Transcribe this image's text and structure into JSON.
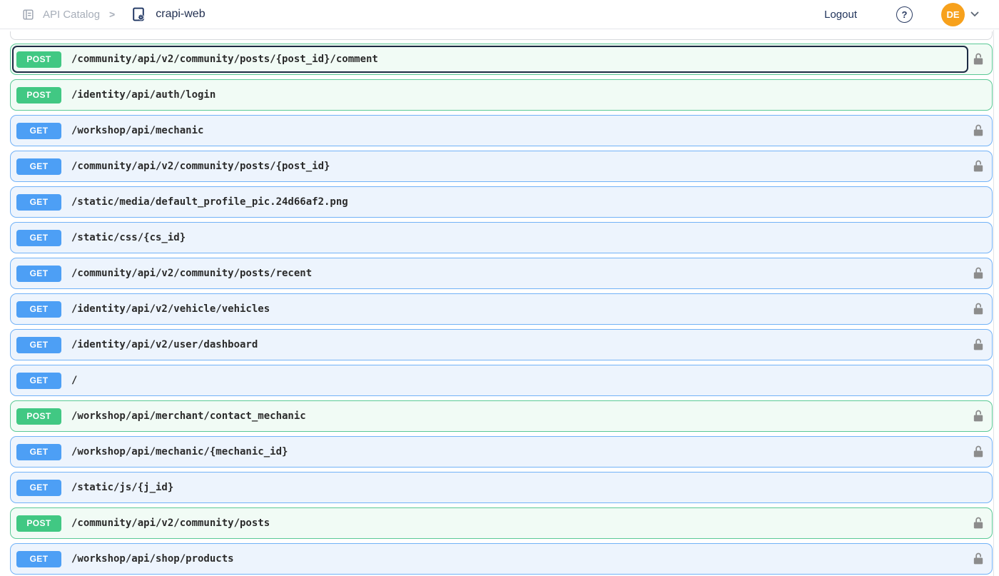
{
  "header": {
    "breadcrumb": {
      "catalog_label": "API Catalog",
      "separator": ">",
      "current": "crapi-web"
    },
    "logout_label": "Logout",
    "help_symbol": "?",
    "avatar_initials": "DE"
  },
  "colors": {
    "post_badge": "#41c883",
    "post_row_bg": "#f1fbf5",
    "post_row_border": "#5bc996",
    "get_badge": "#4d9ff5",
    "get_row_bg": "#edf4fd",
    "get_row_border": "#72b2f7",
    "focus_ring": "#1d2b44",
    "lock_gray": "#8c8c8c",
    "avatar_bg": "#f7a11c",
    "navy_text": "#22355c"
  },
  "icons": {
    "catalog": "catalog-icon",
    "api_collection": "api-collection-icon",
    "help": "question-circle-icon",
    "chevron": "chevron-down-icon",
    "lock": "unlock-icon"
  },
  "endpoints": [
    {
      "method": "POST",
      "path": "/community/api/v2/community/posts/{post_id}/comment",
      "locked": true,
      "selected": true
    },
    {
      "method": "POST",
      "path": "/identity/api/auth/login",
      "locked": false,
      "selected": false
    },
    {
      "method": "GET",
      "path": "/workshop/api/mechanic",
      "locked": true,
      "selected": false
    },
    {
      "method": "GET",
      "path": "/community/api/v2/community/posts/{post_id}",
      "locked": true,
      "selected": false
    },
    {
      "method": "GET",
      "path": "/static/media/default_profile_pic.24d66af2.png",
      "locked": false,
      "selected": false
    },
    {
      "method": "GET",
      "path": "/static/css/{cs_id}",
      "locked": false,
      "selected": false
    },
    {
      "method": "GET",
      "path": "/community/api/v2/community/posts/recent",
      "locked": true,
      "selected": false
    },
    {
      "method": "GET",
      "path": "/identity/api/v2/vehicle/vehicles",
      "locked": true,
      "selected": false
    },
    {
      "method": "GET",
      "path": "/identity/api/v2/user/dashboard",
      "locked": true,
      "selected": false
    },
    {
      "method": "GET",
      "path": "/",
      "locked": false,
      "selected": false
    },
    {
      "method": "POST",
      "path": "/workshop/api/merchant/contact_mechanic",
      "locked": true,
      "selected": false
    },
    {
      "method": "GET",
      "path": "/workshop/api/mechanic/{mechanic_id}",
      "locked": true,
      "selected": false
    },
    {
      "method": "GET",
      "path": "/static/js/{j_id}",
      "locked": false,
      "selected": false
    },
    {
      "method": "POST",
      "path": "/community/api/v2/community/posts",
      "locked": true,
      "selected": false
    },
    {
      "method": "GET",
      "path": "/workshop/api/shop/products",
      "locked": true,
      "selected": false
    }
  ]
}
